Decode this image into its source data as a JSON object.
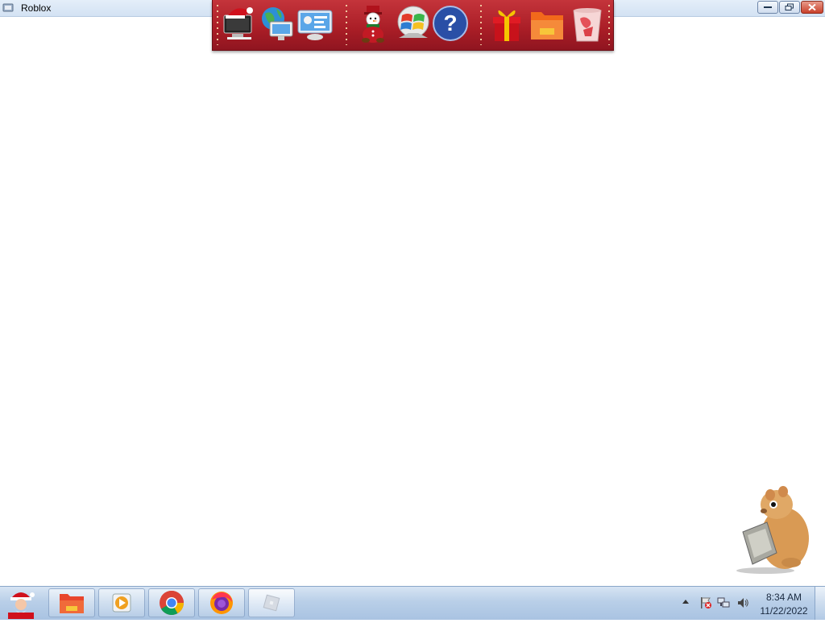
{
  "window": {
    "title": "Roblox",
    "buttons": [
      "minimize",
      "restore",
      "close"
    ]
  },
  "dock": {
    "groups": [
      [
        "computer-icon",
        "network-icon",
        "control-panel-icon"
      ],
      [
        "snowman-icon",
        "windows-logo-icon",
        "help-icon"
      ],
      [
        "gift-icon",
        "folder-icon",
        "recycle-bin-icon"
      ]
    ],
    "colors": {
      "background": "#b0232c"
    }
  },
  "taskbar": {
    "start": "santa-start-icon",
    "buttons": [
      {
        "icon": "folder-icon",
        "active": false
      },
      {
        "icon": "media-player-icon",
        "active": false
      },
      {
        "icon": "chrome-icon",
        "active": false
      },
      {
        "icon": "firefox-icon",
        "active": false
      },
      {
        "icon": "roblox-icon",
        "active": true
      }
    ],
    "tray": {
      "icons": [
        "action-center-flag-icon",
        "network-icon",
        "volume-icon"
      ],
      "time": "8:34 AM",
      "date": "11/22/2022"
    }
  },
  "desktop": {
    "widget": "hamster-icon"
  }
}
